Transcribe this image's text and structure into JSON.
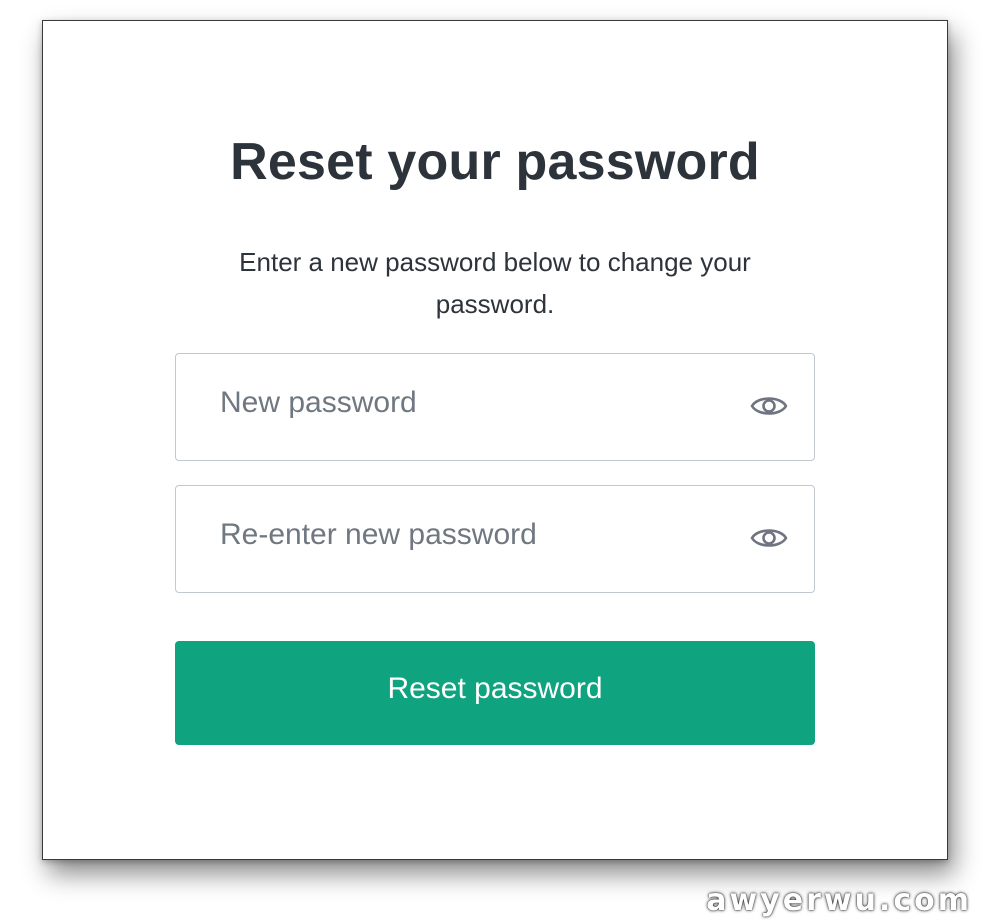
{
  "form": {
    "title": "Reset your password",
    "subtitle": "Enter a new password below to change your password.",
    "new_password": {
      "placeholder": "New password",
      "value": ""
    },
    "confirm_password": {
      "placeholder": "Re-enter new password",
      "value": ""
    },
    "toggle_icon": "eye-icon",
    "submit_label": "Reset password"
  },
  "watermark": "awyerwu.com",
  "colors": {
    "accent": "#10a37f",
    "text": "#2d333a",
    "placeholder": "#6f7780",
    "field_border": "#c2c8d0",
    "icon": "#6e7580"
  }
}
